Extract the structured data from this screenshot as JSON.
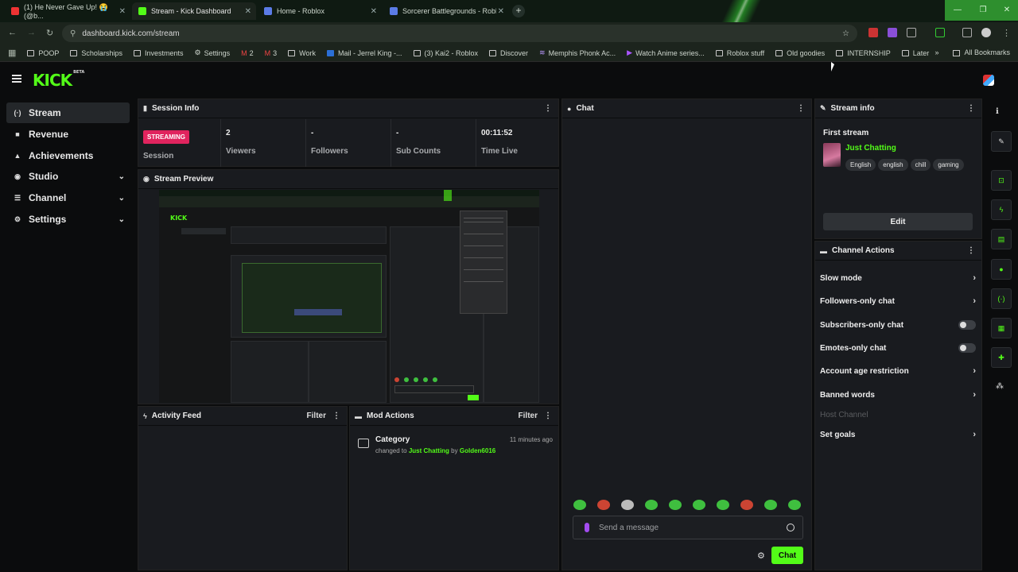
{
  "browser": {
    "tabs": [
      {
        "title": "(1) He Never Gave Up! 😭 (@b...",
        "fav": "#e33"
      },
      {
        "title": "Stream - Kick Dashboard",
        "fav": "#53fc18"
      },
      {
        "title": "Home - Roblox",
        "fav": "#5b7be6"
      },
      {
        "title": "Sorcerer Battlegrounds - Roblox",
        "fav": "#5b7be6"
      }
    ],
    "url": "dashboard.kick.com/stream",
    "bookmarks": [
      "POOP",
      "Scholarships",
      "Investments",
      "Settings",
      "2",
      "3",
      "Work",
      "Mail - Jerrel King -...",
      "(3) Kai2 - Roblox",
      "Discover",
      "Memphis Phonk Ac...",
      "Watch Anime series...",
      "Roblox stuff",
      "Old goodies",
      "INTERNSHIP",
      "Later"
    ],
    "all_bookmarks": "All Bookmarks"
  },
  "app": {
    "logo": "KICK",
    "logo_badge": "BETA"
  },
  "sidebar": {
    "items": [
      {
        "label": "Stream",
        "icon": "((·))"
      },
      {
        "label": "Revenue",
        "icon": "■"
      },
      {
        "label": "Achievements",
        "icon": "▲"
      },
      {
        "label": "Studio",
        "icon": "◉"
      },
      {
        "label": "Channel",
        "icon": "☰"
      },
      {
        "label": "Settings",
        "icon": "⚙"
      }
    ]
  },
  "session": {
    "title": "Session Info",
    "status_badge": "STREAMING",
    "status_label": "Session",
    "stats": [
      {
        "value": "2",
        "label": "Viewers"
      },
      {
        "value": "-",
        "label": "Followers"
      },
      {
        "value": "-",
        "label": "Sub Counts"
      },
      {
        "value": "00:11:52",
        "label": "Time Live"
      }
    ]
  },
  "preview": {
    "title": "Stream Preview"
  },
  "activity": {
    "title": "Activity Feed",
    "filter": "Filter"
  },
  "mod_actions": {
    "title": "Mod Actions",
    "filter": "Filter",
    "entry": {
      "title": "Category",
      "time": "11 minutes ago",
      "prefix": "changed to",
      "category": "Just Chatting",
      "by": "by",
      "user": "Golden6016"
    }
  },
  "chat": {
    "title": "Chat",
    "placeholder": "Send a message",
    "send_label": "Chat"
  },
  "stream_info": {
    "title": "Stream info",
    "stream_title": "First stream",
    "category": "Just Chatting",
    "tags": [
      "English",
      "english",
      "chill",
      "gaming"
    ],
    "edit_label": "Edit"
  },
  "channel_actions": {
    "title": "Channel Actions",
    "rows": [
      {
        "label": "Slow mode",
        "control": "chevron"
      },
      {
        "label": "Followers-only chat",
        "control": "chevron"
      },
      {
        "label": "Subscribers-only chat",
        "control": "toggle"
      },
      {
        "label": "Emotes-only chat",
        "control": "toggle"
      },
      {
        "label": "Account age restriction",
        "control": "chevron"
      },
      {
        "label": "Banned words",
        "control": "chevron"
      },
      {
        "label": "Host Channel",
        "control": "disabled"
      },
      {
        "label": "Set goals",
        "control": "chevron"
      }
    ]
  },
  "colors": {
    "brand": "#53fc18",
    "streaming_badge": "#e0245e",
    "panel_bg": "#191b1f",
    "page_bg": "#0b0c0d"
  }
}
